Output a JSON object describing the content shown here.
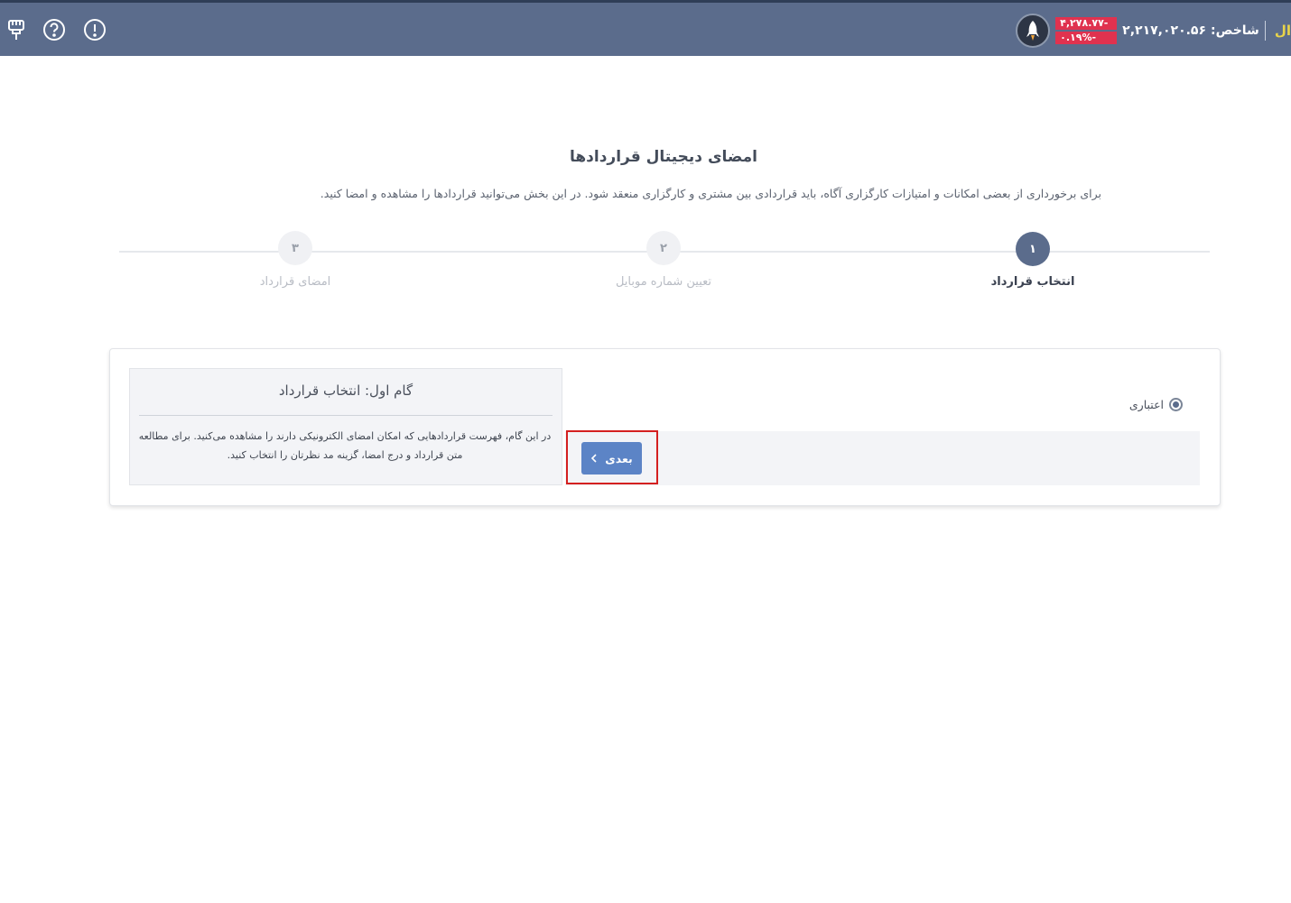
{
  "topbar": {
    "cut_label": "ال",
    "index_label": "شاخص:",
    "index_value": "۲,۲۱۷,۰۲۰.۵۶",
    "change_value": "-۴,۲۷۸.۷۷",
    "change_percent": "-۰.۱۹%",
    "icons": [
      "rocket-icon",
      "alert-icon",
      "help-icon",
      "plug-icon"
    ],
    "accent_color": "#5b6c8c",
    "negative_color": "#e0324f"
  },
  "page": {
    "title": "امضای دیجیتال قراردادها",
    "subtitle": "برای برخورداری از بعضی امکانات و امتیازات کارگزاری آگاه، باید قراردادی بین مشتری و کارگزاری منعقد شود. در این بخش می‌توانید قراردادها را مشاهده و امضا کنید."
  },
  "steps": [
    {
      "number": "۱",
      "label": "انتخاب قرارداد",
      "active": true
    },
    {
      "number": "۲",
      "label": "تعیین شماره موبایل",
      "active": false
    },
    {
      "number": "۳",
      "label": "امضای قرارداد",
      "active": false
    }
  ],
  "card": {
    "radio_label": "اعتباری",
    "radio_selected": true,
    "info_title": "گام اول: انتخاب قرارداد",
    "info_text": "در این گام، فهرست قراردادهایی که امکان امضای الکترونیکی دارند را مشاهده می‌کنید. برای مطالعه متن قرارداد و درج امضا، گزینه مد نظرتان را انتخاب کنید.",
    "next_button": "بعدی"
  }
}
